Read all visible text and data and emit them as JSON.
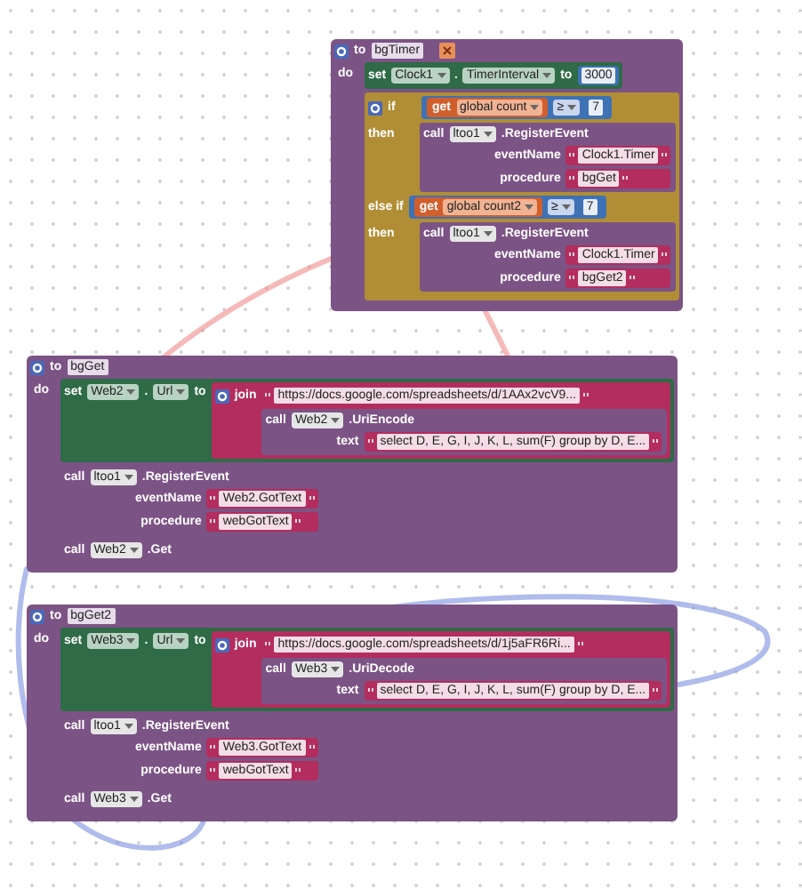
{
  "procedures": [
    {
      "keyword": "to",
      "name": "bgTimer",
      "warning": true,
      "do_label": "do",
      "statements": [
        {
          "kind": "set",
          "keyword": "set",
          "component": "Clock1",
          "dot": ".",
          "property": "TimerInterval",
          "to": "to",
          "value": {
            "kind": "number",
            "text": "3000"
          }
        },
        {
          "kind": "if",
          "branches": [
            {
              "label": "if",
              "condition": {
                "kind": "compare",
                "left": {
                  "kind": "get",
                  "keyword": "get",
                  "variable": "global count"
                },
                "op": "≥",
                "right": {
                  "kind": "number",
                  "text": "7"
                }
              },
              "then_label": "then",
              "body": [
                {
                  "kind": "call",
                  "keyword": "call",
                  "component": "ltoo1",
                  "method": ".RegisterEvent",
                  "args": [
                    {
                      "name": "eventName",
                      "value": {
                        "kind": "text",
                        "text": "Clock1.Timer"
                      }
                    },
                    {
                      "name": "procedure",
                      "value": {
                        "kind": "text",
                        "text": "bgGet"
                      }
                    }
                  ]
                }
              ]
            },
            {
              "label": "else if",
              "condition": {
                "kind": "compare",
                "left": {
                  "kind": "get",
                  "keyword": "get",
                  "variable": "global count2"
                },
                "op": "≥",
                "right": {
                  "kind": "number",
                  "text": "7"
                }
              },
              "then_label": "then",
              "body": [
                {
                  "kind": "call",
                  "keyword": "call",
                  "component": "ltoo1",
                  "method": ".RegisterEvent",
                  "args": [
                    {
                      "name": "eventName",
                      "value": {
                        "kind": "text",
                        "text": "Clock1.Timer"
                      }
                    },
                    {
                      "name": "procedure",
                      "value": {
                        "kind": "text",
                        "text": "bgGet2"
                      }
                    }
                  ]
                }
              ]
            }
          ]
        }
      ]
    },
    {
      "keyword": "to",
      "name": "bgGet",
      "warning": false,
      "do_label": "do",
      "statements": [
        {
          "kind": "set",
          "keyword": "set",
          "component": "Web2",
          "dot": ".",
          "property": "Url",
          "to": "to",
          "value": {
            "kind": "join",
            "keyword": "join",
            "items": [
              {
                "kind": "text",
                "text": "https://docs.google.com/spreadsheets/d/1AAx2vcV9..."
              },
              {
                "kind": "call",
                "keyword": "call",
                "component": "Web2",
                "method": ".UriEncode",
                "args": [
                  {
                    "name": "text",
                    "value": {
                      "kind": "text",
                      "text": "select D, E, G, I, J, K, L, sum(F) group by D, E..."
                    }
                  }
                ]
              }
            ]
          }
        },
        {
          "kind": "call",
          "keyword": "call",
          "component": "ltoo1",
          "method": ".RegisterEvent",
          "args": [
            {
              "name": "eventName",
              "value": {
                "kind": "text",
                "text": "Web2.GotText"
              }
            },
            {
              "name": "procedure",
              "value": {
                "kind": "text",
                "text": "webGotText"
              }
            }
          ]
        },
        {
          "kind": "call",
          "keyword": "call",
          "component": "Web2",
          "method": ".Get"
        }
      ]
    },
    {
      "keyword": "to",
      "name": "bgGet2",
      "warning": false,
      "do_label": "do",
      "statements": [
        {
          "kind": "set",
          "keyword": "set",
          "component": "Web3",
          "dot": ".",
          "property": "Url",
          "to": "to",
          "value": {
            "kind": "join",
            "keyword": "join",
            "items": [
              {
                "kind": "text",
                "text": "https://docs.google.com/spreadsheets/d/1j5aFR6Ri..."
              },
              {
                "kind": "call",
                "keyword": "call",
                "component": "Web3",
                "method": ".UriDecode",
                "args": [
                  {
                    "name": "text",
                    "value": {
                      "kind": "text",
                      "text": "select D, E, G, I, J, K, L, sum(F) group by D, E..."
                    }
                  }
                ]
              }
            ]
          }
        },
        {
          "kind": "call",
          "keyword": "call",
          "component": "ltoo1",
          "method": ".RegisterEvent",
          "args": [
            {
              "name": "eventName",
              "value": {
                "kind": "text",
                "text": "Web3.GotText"
              }
            },
            {
              "name": "procedure",
              "value": {
                "kind": "text",
                "text": "webGotText"
              }
            }
          ]
        },
        {
          "kind": "call",
          "keyword": "call",
          "component": "Web3",
          "method": ".Get"
        }
      ]
    }
  ]
}
